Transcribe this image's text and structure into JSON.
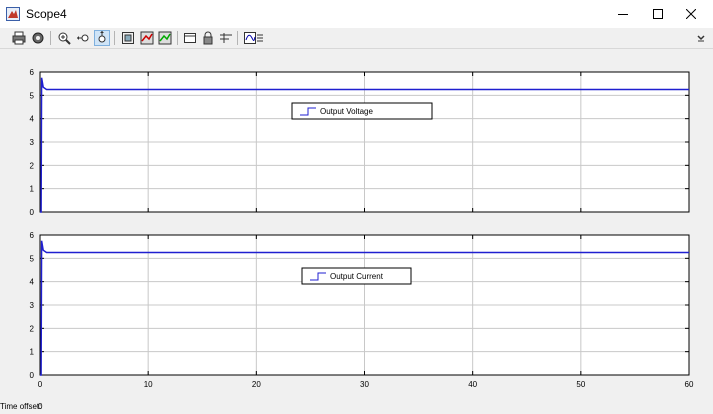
{
  "window": {
    "title": "Scope4"
  },
  "status": {
    "time_offset_label": "Time offset:",
    "time_offset_value": "0"
  },
  "colors": {
    "signal": "#1f1fd0",
    "plot_bg": "#ffffff",
    "figure_bg": "#f0f0f0",
    "grid": "#c8c8c8"
  },
  "toolbar": {
    "icons": [
      "print-icon",
      "settings-icon",
      "zoom-in-icon",
      "zoom-x-icon",
      "zoom-y-icon",
      "autoscale-icon",
      "save-axes-icon",
      "restore-axes-icon",
      "floating-scope-icon",
      "lock-icon",
      "signal-selection-icon",
      "legend-icon"
    ],
    "overflow_icon": "chevron-icon"
  },
  "chart_data": [
    {
      "type": "line",
      "xlim": [
        0,
        60
      ],
      "ylim": [
        0,
        6
      ],
      "yticks": [
        "0",
        "1",
        "2",
        "3",
        "4",
        "5",
        "6"
      ],
      "xticks": [],
      "grid": true,
      "legend": {
        "placement": "top-center"
      },
      "series": [
        {
          "name": "Output Voltage",
          "x": [
            0,
            0.1,
            0.15,
            0.3,
            0.6,
            60
          ],
          "y": [
            0,
            0,
            5.75,
            5.35,
            5.25,
            5.25
          ]
        }
      ]
    },
    {
      "type": "line",
      "xlim": [
        0,
        60
      ],
      "ylim": [
        0,
        6
      ],
      "yticks": [
        "0",
        "1",
        "2",
        "3",
        "4",
        "5",
        "6"
      ],
      "xticks": [
        "0",
        "10",
        "20",
        "30",
        "40",
        "50",
        "60"
      ],
      "grid": true,
      "legend": {
        "placement": "top-center"
      },
      "series": [
        {
          "name": "Output Current",
          "x": [
            0,
            0.1,
            0.15,
            0.3,
            0.6,
            60
          ],
          "y": [
            0,
            0,
            5.75,
            5.35,
            5.25,
            5.25
          ]
        }
      ]
    }
  ]
}
